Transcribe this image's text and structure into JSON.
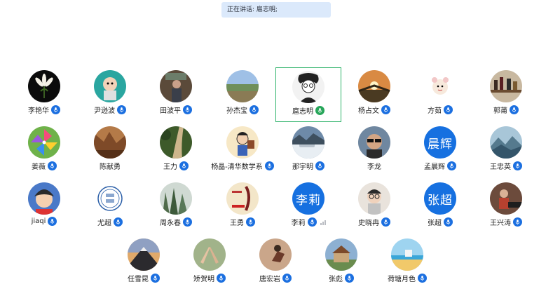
{
  "speaking": {
    "text": "正在讲话: 扈志明;"
  },
  "participants": [
    {
      "name": "李艳华",
      "avatar": "lily",
      "mic": "on"
    },
    {
      "name": "尹逊波",
      "avatar": "cartoon",
      "mic": "on"
    },
    {
      "name": "田波平",
      "avatar": "person",
      "mic": "on"
    },
    {
      "name": "孙杰宝",
      "avatar": "field",
      "mic": "on"
    },
    {
      "name": "扈志明",
      "avatar": "sketch",
      "mic": "speaking",
      "active": true
    },
    {
      "name": "杨占文",
      "avatar": "sunset",
      "mic": "on"
    },
    {
      "name": "方茹",
      "avatar": "sheep",
      "mic": "on"
    },
    {
      "name": "郭莆",
      "avatar": "shelf",
      "mic": "on"
    },
    {
      "name": "姜薇",
      "avatar": "pinwheel",
      "mic": "on"
    },
    {
      "name": "陈献勇",
      "avatar": "canyon",
      "mic": "none"
    },
    {
      "name": "王力",
      "avatar": "path",
      "mic": "on"
    },
    {
      "name": "杨晶-清华数学系",
      "avatar": "doodle",
      "mic": "on"
    },
    {
      "name": "那宇明",
      "avatar": "snowcar",
      "mic": "on"
    },
    {
      "name": "李龙",
      "avatar": "sunglasses",
      "mic": "none"
    },
    {
      "name": "孟晨辉",
      "avatar": "text",
      "text": "晨辉",
      "color": "#1670e0",
      "mic": "on"
    },
    {
      "name": "王忠英",
      "avatar": "mountains",
      "mic": "on"
    },
    {
      "name": "jiaqi",
      "avatar": "anime",
      "mic": "on"
    },
    {
      "name": "尤超",
      "avatar": "seal",
      "mic": "on"
    },
    {
      "name": "周永春",
      "avatar": "peaks",
      "mic": "on"
    },
    {
      "name": "王勇",
      "avatar": "math",
      "mic": "on"
    },
    {
      "name": "李莉",
      "avatar": "text",
      "text": "李莉",
      "color": "#1670e0",
      "mic": "on",
      "volume": true
    },
    {
      "name": "史晓冉",
      "avatar": "glasses",
      "mic": "on"
    },
    {
      "name": "张超",
      "avatar": "text",
      "text": "张超",
      "color": "#1670e0",
      "mic": "on"
    },
    {
      "name": "王兴涛",
      "avatar": "piano",
      "mic": "on"
    },
    {
      "name": "任雪昆",
      "avatar": "volcano",
      "mic": "on"
    },
    {
      "name": "矫贺明",
      "avatar": "hands",
      "mic": "on"
    },
    {
      "name": "唐宏岩",
      "avatar": "dance",
      "mic": "on"
    },
    {
      "name": "张彪",
      "avatar": "house",
      "mic": "on"
    },
    {
      "name": "荷塘月色",
      "avatar": "beach",
      "mic": "on"
    }
  ]
}
